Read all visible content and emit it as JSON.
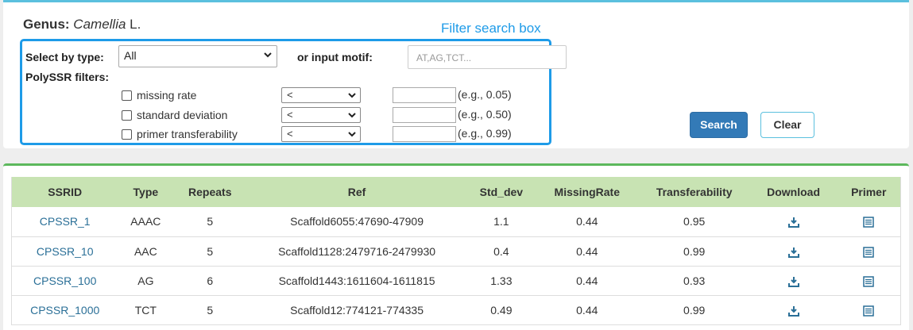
{
  "genus": {
    "label": "Genus:",
    "name": "Camellia",
    "author": "L."
  },
  "filter_caption": "Filter search box",
  "filters": {
    "type_label": "Select by type:",
    "type_value": "All",
    "motif_label": "or input motif:",
    "motif_placeholder": "AT,AG,TCT...",
    "polyssr_label": "PolySSR filters:",
    "rows": [
      {
        "label": "missing rate",
        "op": "<",
        "hint": "(e.g., 0.05)"
      },
      {
        "label": "standard deviation",
        "op": "<",
        "hint": "(e.g., 0.50)"
      },
      {
        "label": "primer transferability",
        "op": "<",
        "hint": "(e.g., 0.99)"
      }
    ]
  },
  "buttons": {
    "search": "Search",
    "clear": "Clear"
  },
  "table": {
    "headers": [
      "SSRID",
      "Type",
      "Repeats",
      "Ref",
      "Std_dev",
      "MissingRate",
      "Transferability",
      "Download",
      "Primer"
    ],
    "rows": [
      {
        "id": "CPSSR_1",
        "type": "AAAC",
        "repeats": "5",
        "ref": "Scaffold6055:47690-47909",
        "std": "1.1",
        "miss": "0.44",
        "trans": "0.95"
      },
      {
        "id": "CPSSR_10",
        "type": "AAC",
        "repeats": "5",
        "ref": "Scaffold1128:2479716-2479930",
        "std": "0.4",
        "miss": "0.44",
        "trans": "0.99"
      },
      {
        "id": "CPSSR_100",
        "type": "AG",
        "repeats": "6",
        "ref": "Scaffold1443:1611604-1611815",
        "std": "1.33",
        "miss": "0.44",
        "trans": "0.93"
      },
      {
        "id": "CPSSR_1000",
        "type": "TCT",
        "repeats": "5",
        "ref": "Scaffold12:774121-774335",
        "std": "0.49",
        "miss": "0.44",
        "trans": "0.99"
      }
    ]
  },
  "icons": {
    "download": "download-icon",
    "primer": "list-icon"
  },
  "colors": {
    "accent_blue": "#1e9be8",
    "button_blue": "#337ab7",
    "header_green": "#c8e3b3",
    "link": "#2a6f97"
  }
}
